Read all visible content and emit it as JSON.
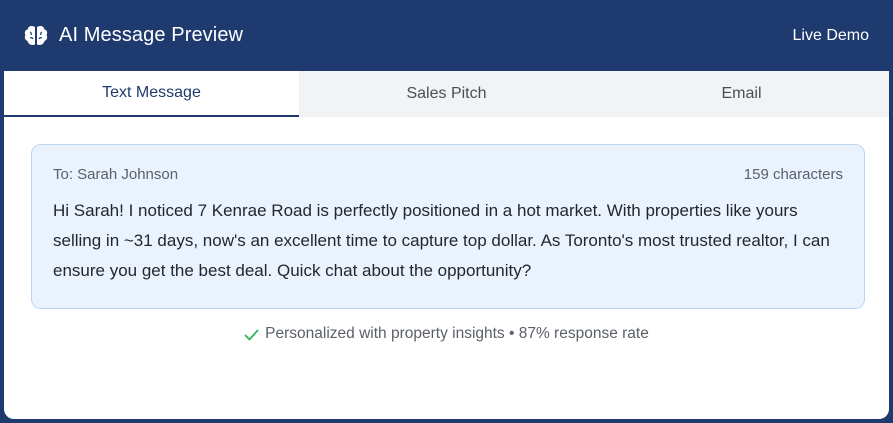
{
  "header": {
    "title": "AI Message Preview",
    "icon": "brain-icon",
    "badge": "Live Demo"
  },
  "tabs": [
    {
      "label": "Text Message",
      "active": true
    },
    {
      "label": "Sales Pitch",
      "active": false
    },
    {
      "label": "Email",
      "active": false
    }
  ],
  "message": {
    "recipient": "To: Sarah Johnson",
    "char_count": "159 characters",
    "body": "Hi Sarah! I noticed 7 Kenrae Road is perfectly positioned in a hot market. With properties like yours selling in ~31 days, now's an excellent time to capture top dollar. As Toronto's most trusted realtor, I can ensure you get the best deal. Quick chat about the opportunity?"
  },
  "footnote": {
    "icon": "checkmark-icon",
    "text": "Personalized with property insights • 87% response rate"
  },
  "colors": {
    "brand_navy": "#1e3a6e",
    "card_bg": "#eaf3fd",
    "check_green": "#2fb45a"
  }
}
